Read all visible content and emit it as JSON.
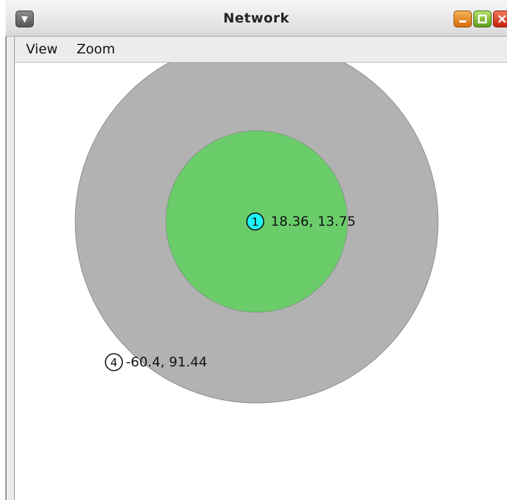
{
  "window": {
    "title": "Network",
    "menu_icon": "window-menu-icon",
    "minimize_icon": "minimize-icon",
    "maximize_icon": "maximize-icon",
    "close_icon": "close-icon"
  },
  "menubar": {
    "items": [
      {
        "label": "View"
      },
      {
        "label": "Zoom"
      }
    ]
  },
  "colors": {
    "outer_ring": "#b2b2b2",
    "inner_ring": "#6acd6a",
    "node_highlight": "#1ef4f8",
    "node_plain": "#ffffff"
  },
  "nodes": [
    {
      "id": "1",
      "coords": "18.36, 13.75",
      "highlighted": true
    },
    {
      "id": "4",
      "coords": "-60.4, 91.44",
      "highlighted": false
    }
  ]
}
